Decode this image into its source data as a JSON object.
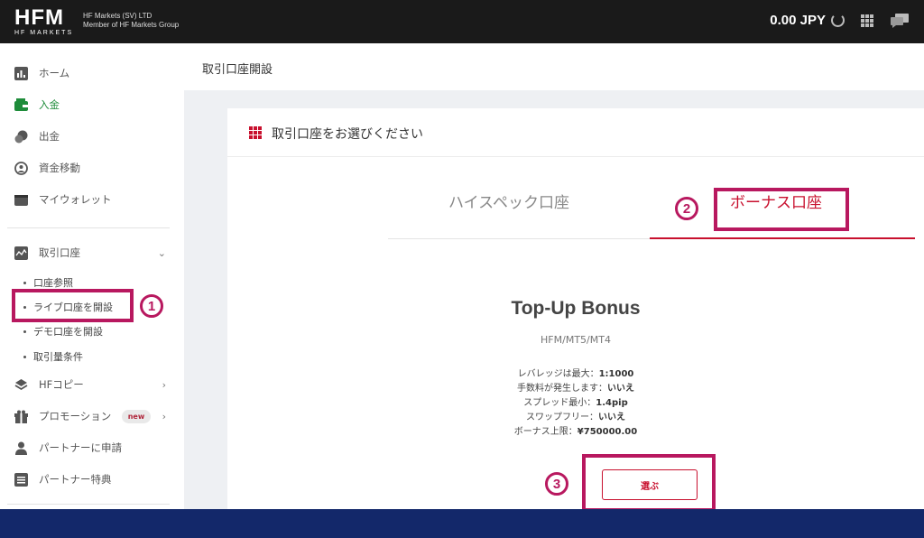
{
  "header": {
    "logo_text": "HFM",
    "logo_sub": "HF MARKETS",
    "company_line1": "HF Markets (SV) LTD",
    "company_line2": "Member of HF Markets Group",
    "balance": "0.00 JPY"
  },
  "sidebar": {
    "items": [
      {
        "label": "ホーム",
        "icon": "bar-chart-icon"
      },
      {
        "label": "入金",
        "icon": "wallet-in-icon"
      },
      {
        "label": "出金",
        "icon": "coins-icon"
      },
      {
        "label": "資金移動",
        "icon": "transfer-icon"
      },
      {
        "label": "マイウォレット",
        "icon": "wallet-icon"
      },
      {
        "label": "取引口座",
        "icon": "chart-line-icon",
        "chevron": "⌄"
      },
      {
        "label": "HFコピー",
        "icon": "layers-icon",
        "chevron": "›"
      },
      {
        "label": "プロモーション",
        "icon": "gift-icon",
        "chevron": "›",
        "badge": "new"
      },
      {
        "label": "パートナーに申請",
        "icon": "user-icon"
      },
      {
        "label": "パートナー特典",
        "icon": "list-icon"
      }
    ],
    "subitems": [
      "口座参照",
      "ライブ口座を開設",
      "デモ口座を開設",
      "取引量条件"
    ]
  },
  "main": {
    "page_title": "取引口座開設",
    "card_title": "取引口座をお選びください",
    "tabs": [
      {
        "label": "ハイスペック口座"
      },
      {
        "label": "ボーナス口座"
      }
    ],
    "plan": {
      "title": "Top-Up Bonus",
      "platform": "HFM/MT5/MT4",
      "features": [
        {
          "label": "レバレッジは最大：",
          "value": "1:1000"
        },
        {
          "label": "手数料が発生します：",
          "value": "いいえ"
        },
        {
          "label": "スプレッド最小：",
          "value": "1.4pip"
        },
        {
          "label": "スワップフリー：",
          "value": "いいえ"
        },
        {
          "label": "ボーナス上限：",
          "value": "¥750000.00"
        }
      ],
      "select_label": "選ぶ"
    }
  },
  "annotations": [
    "1",
    "2",
    "3"
  ],
  "colors": {
    "brand_red": "#c8102e",
    "highlight": "#b8185f",
    "active_green": "#1e8c3a",
    "footer_blue": "#13286a"
  }
}
